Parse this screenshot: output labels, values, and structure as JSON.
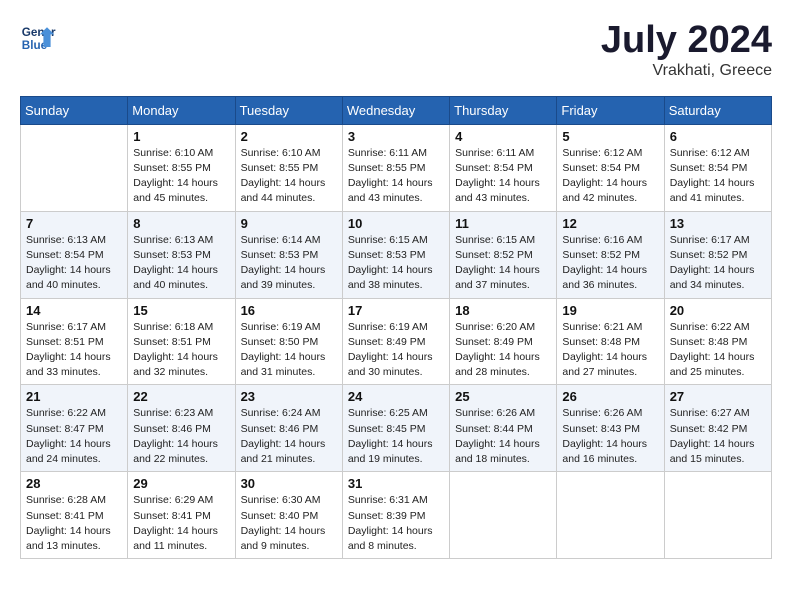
{
  "header": {
    "logo_line1": "General",
    "logo_line2": "Blue",
    "month": "July 2024",
    "location": "Vrakhati, Greece"
  },
  "weekdays": [
    "Sunday",
    "Monday",
    "Tuesday",
    "Wednesday",
    "Thursday",
    "Friday",
    "Saturday"
  ],
  "weeks": [
    [
      {
        "day": "",
        "sunrise": "",
        "sunset": "",
        "daylight": ""
      },
      {
        "day": "1",
        "sunrise": "Sunrise: 6:10 AM",
        "sunset": "Sunset: 8:55 PM",
        "daylight": "Daylight: 14 hours and 45 minutes."
      },
      {
        "day": "2",
        "sunrise": "Sunrise: 6:10 AM",
        "sunset": "Sunset: 8:55 PM",
        "daylight": "Daylight: 14 hours and 44 minutes."
      },
      {
        "day": "3",
        "sunrise": "Sunrise: 6:11 AM",
        "sunset": "Sunset: 8:55 PM",
        "daylight": "Daylight: 14 hours and 43 minutes."
      },
      {
        "day": "4",
        "sunrise": "Sunrise: 6:11 AM",
        "sunset": "Sunset: 8:54 PM",
        "daylight": "Daylight: 14 hours and 43 minutes."
      },
      {
        "day": "5",
        "sunrise": "Sunrise: 6:12 AM",
        "sunset": "Sunset: 8:54 PM",
        "daylight": "Daylight: 14 hours and 42 minutes."
      },
      {
        "day": "6",
        "sunrise": "Sunrise: 6:12 AM",
        "sunset": "Sunset: 8:54 PM",
        "daylight": "Daylight: 14 hours and 41 minutes."
      }
    ],
    [
      {
        "day": "7",
        "sunrise": "Sunrise: 6:13 AM",
        "sunset": "Sunset: 8:54 PM",
        "daylight": "Daylight: 14 hours and 40 minutes."
      },
      {
        "day": "8",
        "sunrise": "Sunrise: 6:13 AM",
        "sunset": "Sunset: 8:53 PM",
        "daylight": "Daylight: 14 hours and 40 minutes."
      },
      {
        "day": "9",
        "sunrise": "Sunrise: 6:14 AM",
        "sunset": "Sunset: 8:53 PM",
        "daylight": "Daylight: 14 hours and 39 minutes."
      },
      {
        "day": "10",
        "sunrise": "Sunrise: 6:15 AM",
        "sunset": "Sunset: 8:53 PM",
        "daylight": "Daylight: 14 hours and 38 minutes."
      },
      {
        "day": "11",
        "sunrise": "Sunrise: 6:15 AM",
        "sunset": "Sunset: 8:52 PM",
        "daylight": "Daylight: 14 hours and 37 minutes."
      },
      {
        "day": "12",
        "sunrise": "Sunrise: 6:16 AM",
        "sunset": "Sunset: 8:52 PM",
        "daylight": "Daylight: 14 hours and 36 minutes."
      },
      {
        "day": "13",
        "sunrise": "Sunrise: 6:17 AM",
        "sunset": "Sunset: 8:52 PM",
        "daylight": "Daylight: 14 hours and 34 minutes."
      }
    ],
    [
      {
        "day": "14",
        "sunrise": "Sunrise: 6:17 AM",
        "sunset": "Sunset: 8:51 PM",
        "daylight": "Daylight: 14 hours and 33 minutes."
      },
      {
        "day": "15",
        "sunrise": "Sunrise: 6:18 AM",
        "sunset": "Sunset: 8:51 PM",
        "daylight": "Daylight: 14 hours and 32 minutes."
      },
      {
        "day": "16",
        "sunrise": "Sunrise: 6:19 AM",
        "sunset": "Sunset: 8:50 PM",
        "daylight": "Daylight: 14 hours and 31 minutes."
      },
      {
        "day": "17",
        "sunrise": "Sunrise: 6:19 AM",
        "sunset": "Sunset: 8:49 PM",
        "daylight": "Daylight: 14 hours and 30 minutes."
      },
      {
        "day": "18",
        "sunrise": "Sunrise: 6:20 AM",
        "sunset": "Sunset: 8:49 PM",
        "daylight": "Daylight: 14 hours and 28 minutes."
      },
      {
        "day": "19",
        "sunrise": "Sunrise: 6:21 AM",
        "sunset": "Sunset: 8:48 PM",
        "daylight": "Daylight: 14 hours and 27 minutes."
      },
      {
        "day": "20",
        "sunrise": "Sunrise: 6:22 AM",
        "sunset": "Sunset: 8:48 PM",
        "daylight": "Daylight: 14 hours and 25 minutes."
      }
    ],
    [
      {
        "day": "21",
        "sunrise": "Sunrise: 6:22 AM",
        "sunset": "Sunset: 8:47 PM",
        "daylight": "Daylight: 14 hours and 24 minutes."
      },
      {
        "day": "22",
        "sunrise": "Sunrise: 6:23 AM",
        "sunset": "Sunset: 8:46 PM",
        "daylight": "Daylight: 14 hours and 22 minutes."
      },
      {
        "day": "23",
        "sunrise": "Sunrise: 6:24 AM",
        "sunset": "Sunset: 8:46 PM",
        "daylight": "Daylight: 14 hours and 21 minutes."
      },
      {
        "day": "24",
        "sunrise": "Sunrise: 6:25 AM",
        "sunset": "Sunset: 8:45 PM",
        "daylight": "Daylight: 14 hours and 19 minutes."
      },
      {
        "day": "25",
        "sunrise": "Sunrise: 6:26 AM",
        "sunset": "Sunset: 8:44 PM",
        "daylight": "Daylight: 14 hours and 18 minutes."
      },
      {
        "day": "26",
        "sunrise": "Sunrise: 6:26 AM",
        "sunset": "Sunset: 8:43 PM",
        "daylight": "Daylight: 14 hours and 16 minutes."
      },
      {
        "day": "27",
        "sunrise": "Sunrise: 6:27 AM",
        "sunset": "Sunset: 8:42 PM",
        "daylight": "Daylight: 14 hours and 15 minutes."
      }
    ],
    [
      {
        "day": "28",
        "sunrise": "Sunrise: 6:28 AM",
        "sunset": "Sunset: 8:41 PM",
        "daylight": "Daylight: 14 hours and 13 minutes."
      },
      {
        "day": "29",
        "sunrise": "Sunrise: 6:29 AM",
        "sunset": "Sunset: 8:41 PM",
        "daylight": "Daylight: 14 hours and 11 minutes."
      },
      {
        "day": "30",
        "sunrise": "Sunrise: 6:30 AM",
        "sunset": "Sunset: 8:40 PM",
        "daylight": "Daylight: 14 hours and 9 minutes."
      },
      {
        "day": "31",
        "sunrise": "Sunrise: 6:31 AM",
        "sunset": "Sunset: 8:39 PM",
        "daylight": "Daylight: 14 hours and 8 minutes."
      },
      {
        "day": "",
        "sunrise": "",
        "sunset": "",
        "daylight": ""
      },
      {
        "day": "",
        "sunrise": "",
        "sunset": "",
        "daylight": ""
      },
      {
        "day": "",
        "sunrise": "",
        "sunset": "",
        "daylight": ""
      }
    ]
  ]
}
